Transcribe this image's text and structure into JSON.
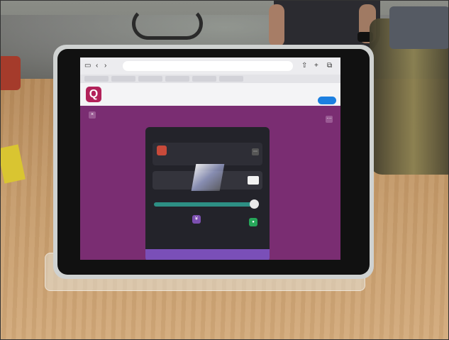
{
  "browser": {
    "url": "",
    "tabs": [
      "",
      "",
      "",
      "",
      "",
      ""
    ]
  },
  "app_banner": {
    "logo_letter": "Q",
    "name": "",
    "open_button": ""
  },
  "modal": {
    "title": "",
    "song_title": "",
    "song_sub": "",
    "notice_text": "",
    "notice_button": "",
    "volume_label": "",
    "stat_left_label": "",
    "stat_left_value": "",
    "stat_right_label": "",
    "stat_right_value": "",
    "footer": ""
  },
  "colors": {
    "page_bg": "#7a2d72",
    "accent_teal": "#2d8f84",
    "footer_purple": "#7a4fb8",
    "app_brand": "#b2225a",
    "open_button": "#1c7fe0"
  },
  "slider_level": 0.95
}
